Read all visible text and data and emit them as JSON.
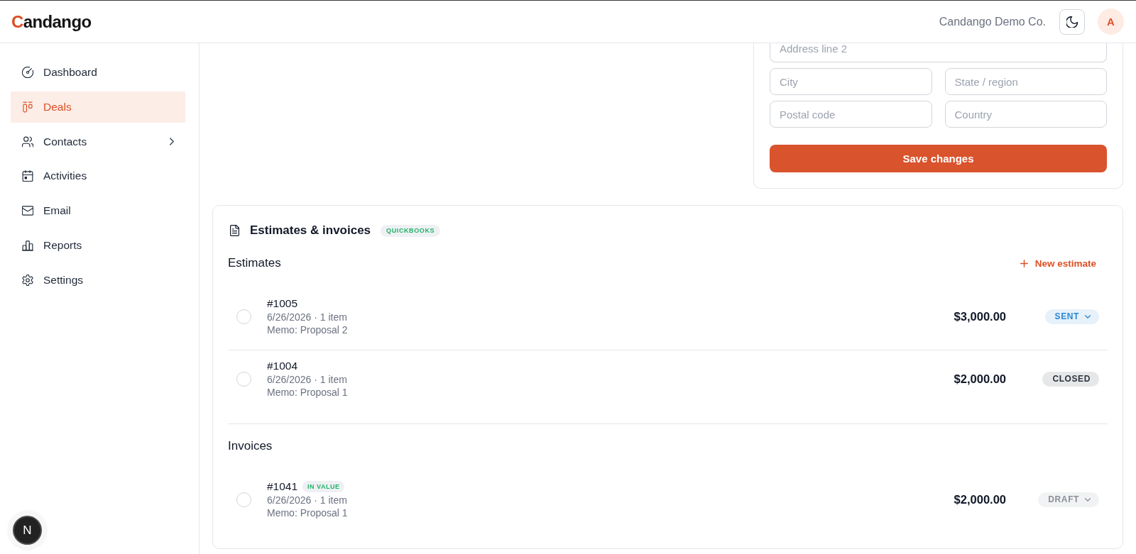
{
  "header": {
    "logo": "Candango",
    "company": "Candango Demo Co.",
    "avatar": "A"
  },
  "sidebar": {
    "items": [
      {
        "label": "Dashboard",
        "selected": false,
        "has_submenu": false
      },
      {
        "label": "Deals",
        "selected": true,
        "has_submenu": false
      },
      {
        "label": "Contacts",
        "selected": false,
        "has_submenu": true
      },
      {
        "label": "Activities",
        "selected": false,
        "has_submenu": false
      },
      {
        "label": "Email",
        "selected": false,
        "has_submenu": false
      },
      {
        "label": "Reports",
        "selected": false,
        "has_submenu": false
      },
      {
        "label": "Settings",
        "selected": false,
        "has_submenu": false
      }
    ]
  },
  "address_form": {
    "fields": [
      {
        "placeholder": "Address line 2"
      },
      {
        "placeholder": "City"
      },
      {
        "placeholder": "State / region"
      },
      {
        "placeholder": "Postal code"
      },
      {
        "placeholder": "Country"
      }
    ],
    "save_button": "Save changes"
  },
  "documents": {
    "title": "Estimates & invoices",
    "badge": "QUICKBOOKS",
    "sections": [
      {
        "heading": "Estimates",
        "action": "New estimate",
        "rows": [
          {
            "number": "#1005",
            "meta": "6/26/2026 · 1 item",
            "memo": "Memo: Proposal 2",
            "amount": "$3,000.00",
            "checked": false,
            "status": {
              "label": "SENT",
              "color": "#2b87d3",
              "has_menu": true
            }
          },
          {
            "number": "#1004",
            "meta": "6/26/2026 · 1 item",
            "memo": "Memo: Proposal 1",
            "amount": "$2,000.00",
            "checked": false,
            "status": {
              "label": "CLOSED",
              "color": "#2e3440",
              "has_menu": false
            }
          }
        ]
      },
      {
        "heading": "Invoices",
        "rows": [
          {
            "number": "#1041",
            "tag": "IN VALUE",
            "meta": "6/26/2026 · 1 item",
            "memo": "Memo: Proposal 1",
            "amount": "$2,000.00",
            "checked": false,
            "status": {
              "label": "DRAFT",
              "color": "#8b9099",
              "has_menu": true
            }
          }
        ]
      }
    ]
  },
  "dev_indicator": "N"
}
